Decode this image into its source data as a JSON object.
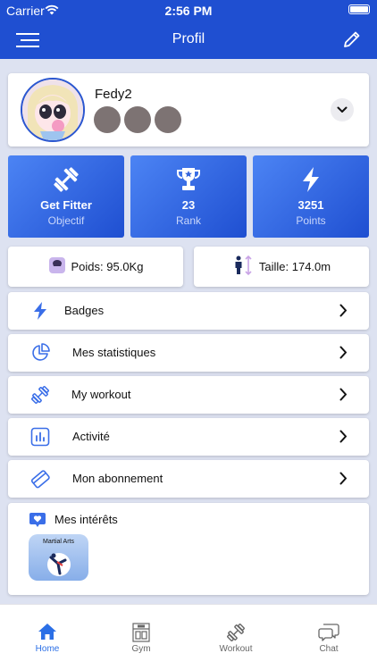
{
  "status_bar": {
    "carrier": "Carrier",
    "time": "2:56 PM"
  },
  "navbar": {
    "title": "Profil"
  },
  "profile": {
    "username": "Fedy2"
  },
  "stats": [
    {
      "value": "Get Fitter",
      "label": "Objectif",
      "icon": "dumbbell-icon"
    },
    {
      "value": "23",
      "label": "Rank",
      "icon": "trophy-icon"
    },
    {
      "value": "3251",
      "label": "Points",
      "icon": "bolt-icon"
    }
  ],
  "measures": {
    "weight": "Poids: 95.0Kg",
    "height": "Taille: 174.0m"
  },
  "menu": [
    {
      "label": "Badges",
      "icon": "bolt-icon"
    },
    {
      "label": "Mes statistiques",
      "icon": "pie-chart-icon"
    },
    {
      "label": "My workout",
      "icon": "dumbbell-icon"
    },
    {
      "label": "Activité",
      "icon": "bar-chart-icon"
    },
    {
      "label": "Mon abonnement",
      "icon": "card-icon"
    }
  ],
  "interests": {
    "title": "Mes intérêts",
    "items": [
      {
        "label": "Martial Arts"
      }
    ]
  },
  "tabbar": [
    {
      "label": "Home",
      "active": true
    },
    {
      "label": "Gym"
    },
    {
      "label": "Workout"
    },
    {
      "label": "Chat"
    }
  ],
  "colors": {
    "primary": "#1f4fd1",
    "accent": "#2b6fe6",
    "background": "#dde2f1"
  }
}
